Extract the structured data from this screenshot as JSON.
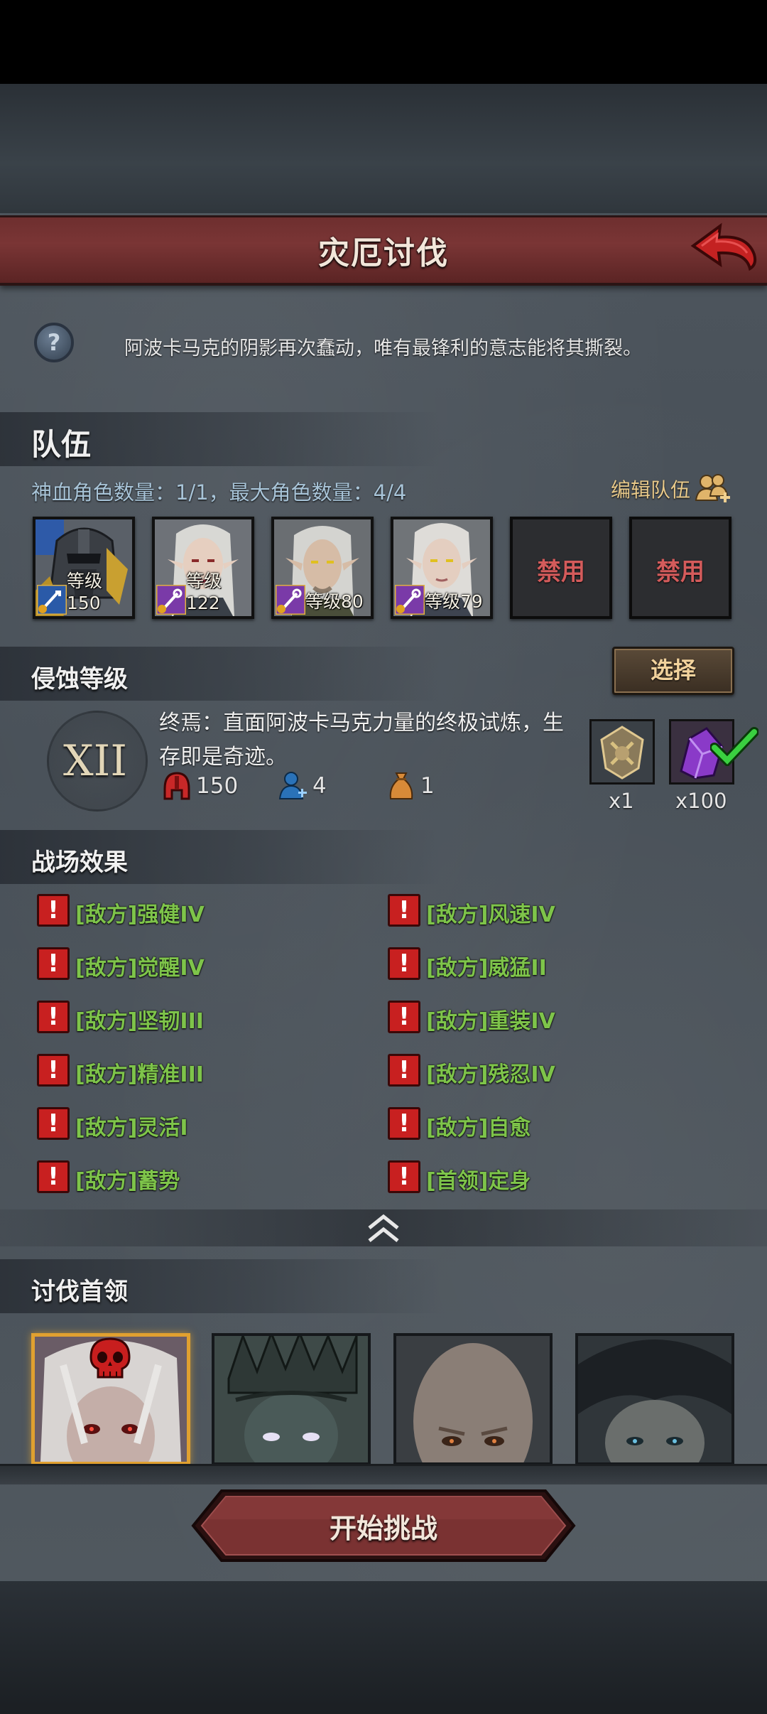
{
  "header": {
    "title": "灾厄讨伐"
  },
  "description": "阿波卡马克的阴影再次蠢动，唯有最锋利的意志能将其撕裂。",
  "team": {
    "title": "队伍",
    "info": "神血角色数量：1/1，最大角色数量：4/4",
    "edit_label": "编辑队伍",
    "slots": [
      {
        "level": "等级150",
        "weapon": "sword-icon"
      },
      {
        "level": "等级122",
        "weapon": "staff-icon"
      },
      {
        "level": "等级80",
        "weapon": "staff-icon"
      },
      {
        "level": "等级79",
        "weapon": "staff-icon"
      },
      {
        "banned": "禁用"
      },
      {
        "banned": "禁用"
      }
    ]
  },
  "erosion": {
    "title": "侵蚀等级",
    "select_label": "选择",
    "level": "XII",
    "desc": "终焉：直面阿波卡马克力量的终极试炼，生存即是奇迹。",
    "stats": {
      "difficulty": "150",
      "players": "4",
      "reward_value": "1"
    },
    "rewards": [
      {
        "count": "x1",
        "icon": "emblem-icon"
      },
      {
        "count": "x100",
        "icon": "crystal-icon",
        "claimed": true
      }
    ]
  },
  "battlefield": {
    "title": "战场效果",
    "effects_left": [
      "[敌方]强健IV",
      "[敌方]觉醒IV",
      "[敌方]坚韧III",
      "[敌方]精准III",
      "[敌方]灵活I",
      "[敌方]蓄势"
    ],
    "effects_right": [
      "[敌方]风速IV",
      "[敌方]威猛II",
      "[敌方]重装IV",
      "[敌方]残忍IV",
      "[敌方]自愈",
      "[首领]定身"
    ]
  },
  "bosses": {
    "title": "讨伐首领"
  },
  "start_button": {
    "label": "开始挑战"
  },
  "colors": {
    "header_red": "#7a3535",
    "effect_green": "#7ec44a",
    "ban_red": "#d35b5b",
    "gold": "#e0a030"
  }
}
